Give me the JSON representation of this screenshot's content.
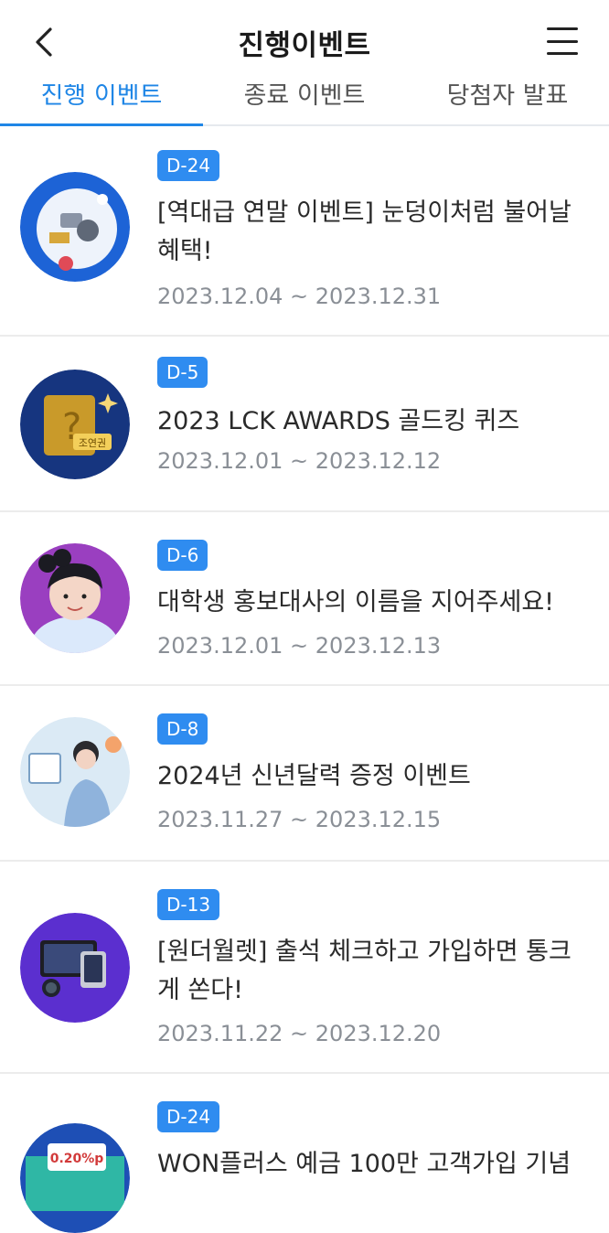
{
  "header": {
    "title": "진행이벤트"
  },
  "tabs": [
    {
      "label": "진행 이벤트",
      "active": true
    },
    {
      "label": "종료 이벤트",
      "active": false
    },
    {
      "label": "당첨자 발표",
      "active": false
    }
  ],
  "events": [
    {
      "dday": "D-24",
      "title": "[역대급 연말 이벤트] 눈덩이처럼 불어날 혜택!",
      "period": "2023.12.04 ~ 2023.12.31"
    },
    {
      "dday": "D-5",
      "title": "2023 LCK AWARDS 골드킹 퀴즈",
      "period": "2023.12.01 ~ 2023.12.12"
    },
    {
      "dday": "D-6",
      "title": "대학생 홍보대사의 이름을 지어주세요!",
      "period": "2023.12.01 ~ 2023.12.13"
    },
    {
      "dday": "D-8",
      "title": "2024년 신년달력 증정 이벤트",
      "period": "2023.11.27 ~ 2023.12.15"
    },
    {
      "dday": "D-13",
      "title": "[원더월렛] 출석 체크하고 가입하면 통크게 쏜다!",
      "period": "2023.11.22 ~ 2023.12.20"
    },
    {
      "dday": "D-24",
      "title": "WON플러스 예금 100만 고객가입 기념",
      "period": ""
    }
  ],
  "thumb_text": {
    "ticket": "조연권",
    "badge": "0.20%p"
  },
  "colors": {
    "accent": "#1f86e6",
    "badge": "#2f8cf0",
    "date": "#8a8f96"
  }
}
